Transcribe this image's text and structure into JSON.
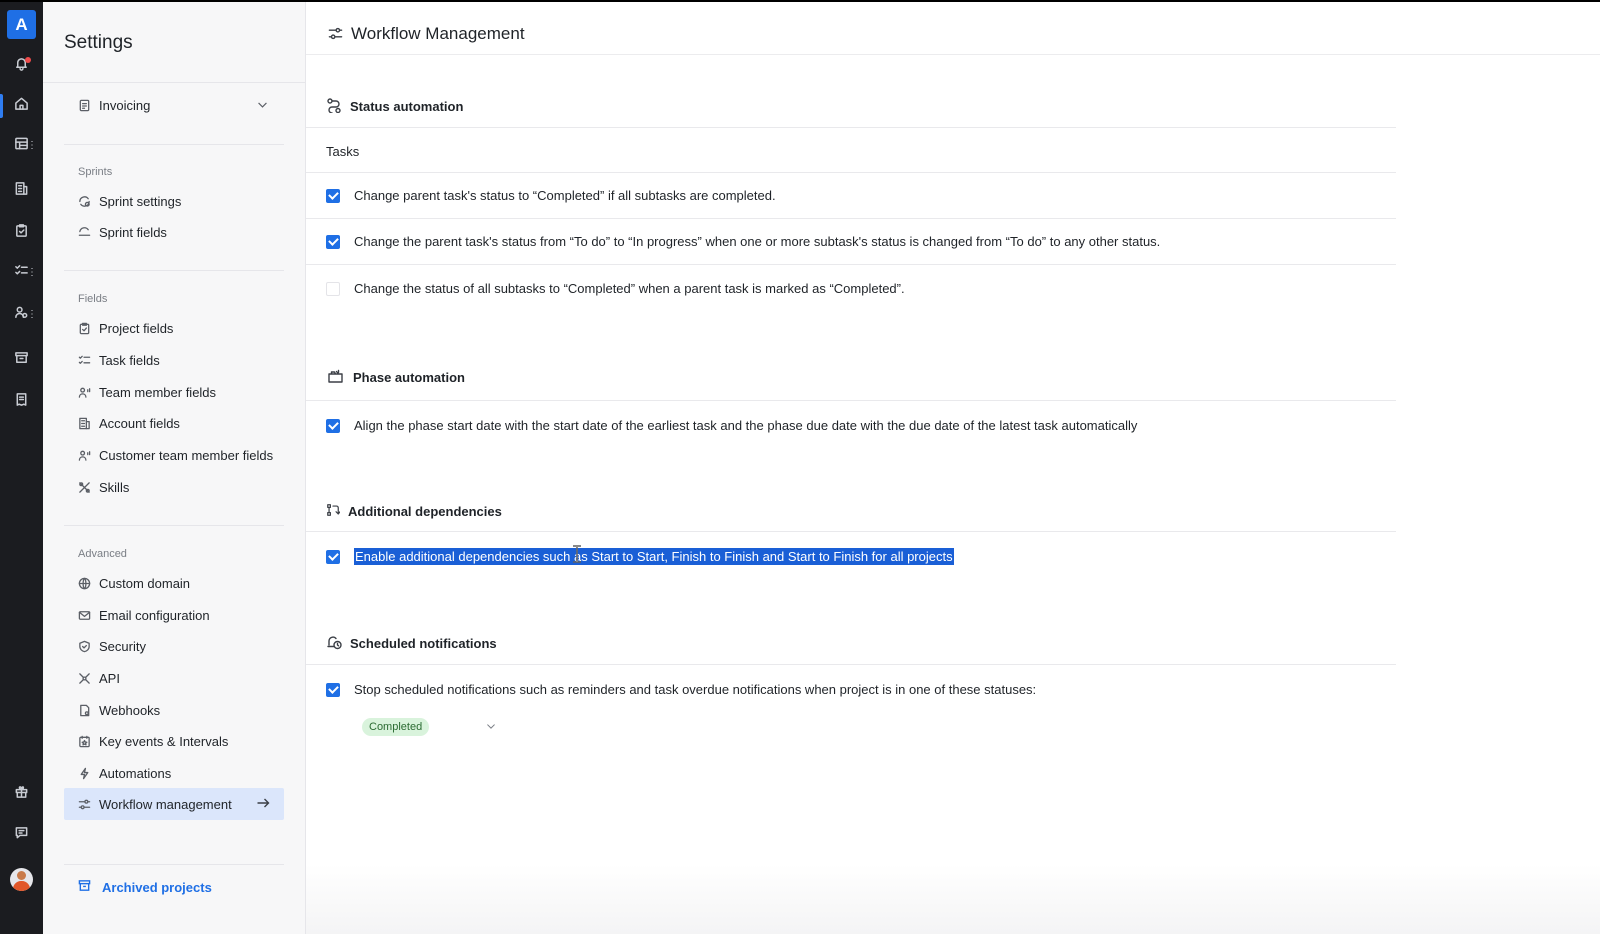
{
  "rail": {
    "logo": "A",
    "icons": [
      "bell-icon",
      "home-icon",
      "table-icon",
      "building-icon",
      "clipboard-icon",
      "checklist-icon",
      "people-icon",
      "archive-icon",
      "receipt-icon",
      "gift-icon",
      "chat-icon"
    ]
  },
  "settings": {
    "title": "Settings",
    "invoicing": "Invoicing",
    "sprints_label": "Sprints",
    "sprint_settings": "Sprint settings",
    "sprint_fields": "Sprint fields",
    "fields_label": "Fields",
    "project_fields": "Project fields",
    "task_fields": "Task fields",
    "team_member_fields": "Team member fields",
    "account_fields": "Account fields",
    "customer_team_member_fields": "Customer team member fields",
    "skills": "Skills",
    "advanced_label": "Advanced",
    "custom_domain": "Custom domain",
    "email_configuration": "Email configuration",
    "security": "Security",
    "api": "API",
    "webhooks": "Webhooks",
    "key_events": "Key events & Intervals",
    "automations": "Automations",
    "workflow_management": "Workflow management",
    "archived_projects": "Archived projects"
  },
  "main": {
    "title": "Workflow Management",
    "status_automation": {
      "title": "Status automation",
      "sub_label": "Tasks",
      "options": [
        {
          "label": "Change parent task's status to “Completed” if all subtasks are completed.",
          "checked": true
        },
        {
          "label": "Change the parent task's status from “To do” to “In progress” when one or more subtask's status is changed from “To do” to any other status.",
          "checked": true
        },
        {
          "label": "Change the status of all subtasks to “Completed” when a parent task is marked as “Completed”.",
          "checked": false
        }
      ]
    },
    "phase_automation": {
      "title": "Phase automation",
      "option": "Align the phase start date with the start date of the earliest task and the phase due date with the due date of the latest task automatically"
    },
    "additional_dependencies": {
      "title": "Additional dependencies",
      "option": "Enable additional dependencies such as Start to Start, Finish to Finish and Start to Finish for all projects"
    },
    "scheduled_notifications": {
      "title": "Scheduled notifications",
      "option": "Stop scheduled notifications such as reminders and task overdue notifications when project is in one of these statuses:",
      "selected_status": "Completed"
    }
  },
  "colors": {
    "accent": "#1f6fe5",
    "rail_bg": "#1b1c20",
    "active_nav_bg": "#dbe6fb",
    "badge_bg": "#d9f3dc",
    "badge_text": "#2b6b32"
  }
}
